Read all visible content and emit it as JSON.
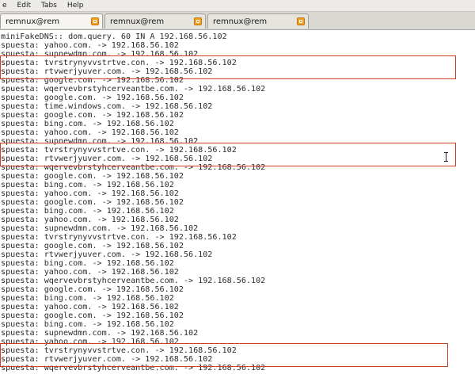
{
  "menu": [
    "e",
    "Edit",
    "Tabs",
    "Help"
  ],
  "tabs": [
    {
      "label": "remnux@rem",
      "active": true
    },
    {
      "label": "remnux@rem",
      "active": false
    },
    {
      "label": "remnux@rem",
      "active": false
    }
  ],
  "terminal": {
    "lines": [
      "miniFakeDNS:: dom.query. 60 IN A 192.168.56.102",
      "spuesta: yahoo.com. -> 192.168.56.102",
      "spuesta: supnewdmn.com. -> 192.168.56.102",
      "spuesta: tvrstrynyvvstrtve.con. -> 192.168.56.102",
      "spuesta: rtvwerjyuver.com. -> 192.168.56.102",
      "spuesta: google.com. -> 192.168.56.102",
      "spuesta: wqervevbrstyhcerveantbe.com. -> 192.168.56.102",
      "spuesta: google.com. -> 192.168.56.102",
      "spuesta: time.windows.com. -> 192.168.56.102",
      "spuesta: google.com. -> 192.168.56.102",
      "spuesta: bing.com. -> 192.168.56.102",
      "spuesta: yahoo.com. -> 192.168.56.102",
      "spuesta: supnewdmn.com. -> 192.168.56.102",
      "spuesta: tvrstrynyvvstrtve.con. -> 192.168.56.102",
      "spuesta: rtvwerjyuver.com. -> 192.168.56.102",
      "spuesta: wqervevbrstyhcerveantbe.com. -> 192.168.56.102",
      "spuesta: google.com. -> 192.168.56.102",
      "spuesta: bing.com. -> 192.168.56.102",
      "spuesta: yahoo.com. -> 192.168.56.102",
      "spuesta: google.com. -> 192.168.56.102",
      "spuesta: bing.com. -> 192.168.56.102",
      "spuesta: yahoo.com. -> 192.168.56.102",
      "spuesta: supnewdmn.com. -> 192.168.56.102",
      "spuesta: tvrstrynyvvstrtve.con. -> 192.168.56.102",
      "spuesta: google.com. -> 192.168.56.102",
      "spuesta: rtvwerjyuver.com. -> 192.168.56.102",
      "spuesta: bing.com. -> 192.168.56.102",
      "spuesta: yahoo.com. -> 192.168.56.102",
      "spuesta: wqervevbrstyhcerveantbe.com. -> 192.168.56.102",
      "spuesta: google.com. -> 192.168.56.102",
      "spuesta: bing.com. -> 192.168.56.102",
      "spuesta: yahoo.com. -> 192.168.56.102",
      "spuesta: google.com. -> 192.168.56.102",
      "spuesta: bing.com. -> 192.168.56.102",
      "spuesta: supnewdmn.com. -> 192.168.56.102",
      "spuesta: yahoo.com. -> 192.168.56.102",
      "spuesta: tvrstrynyvvstrtve.con. -> 192.168.56.102",
      "spuesta: rtvwerjyuver.com. -> 192.168.56.102",
      "spuesta: wqervevbrstyhcerveantbe.com. -> 192.168.56.102"
    ],
    "highlighted_line_pairs": [
      [
        3,
        4
      ],
      [
        13,
        14
      ],
      [
        36,
        37
      ]
    ],
    "highlight_color": "#d23a2a",
    "text_color": "#2b2b2b",
    "background_color": "#ffffff"
  },
  "icons": {
    "tab_close": "tab-close-icon",
    "cursor": "text-cursor-icon"
  }
}
